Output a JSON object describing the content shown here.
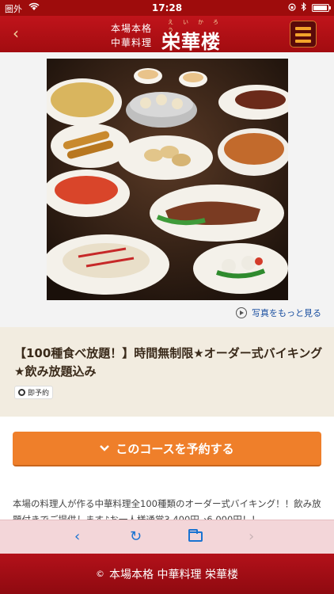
{
  "status_bar": {
    "carrier": "圏外",
    "time": "17:28",
    "battery_icon": "battery-icon",
    "wifi_icon": "wifi-icon"
  },
  "header": {
    "back_icon": "‹",
    "logo": {
      "line1": "本場本格",
      "line2": "中華料理",
      "name": "栄華楼",
      "ruby": "えいかろう"
    },
    "menu_icon": "hamburger-menu-icon"
  },
  "photo": {
    "more_label": "写真をもっと見る"
  },
  "course": {
    "title": "【100種食べ放題！】時間無制限★オーダー式バイキング★飲み放題込み",
    "badge": "即予約"
  },
  "reserve_button": {
    "label": "このコースを予約する"
  },
  "description": {
    "text": "本場の料理人が作る中華料理全100種類のオーダー式バイキング！！飲み放題付きでご提供します♪お一人様通常3,400円→6,000円！！"
  },
  "toolbar": {
    "back": "‹",
    "reload": "↻",
    "forward": "›"
  },
  "footer": {
    "copyright": "©",
    "text": "本場本格 中華料理 栄華楼"
  },
  "colors": {
    "header_red": "#b3111a",
    "button_orange": "#ef7f2a",
    "toolbar_pink": "#f3d6d9",
    "link_blue": "#1a73d1"
  }
}
